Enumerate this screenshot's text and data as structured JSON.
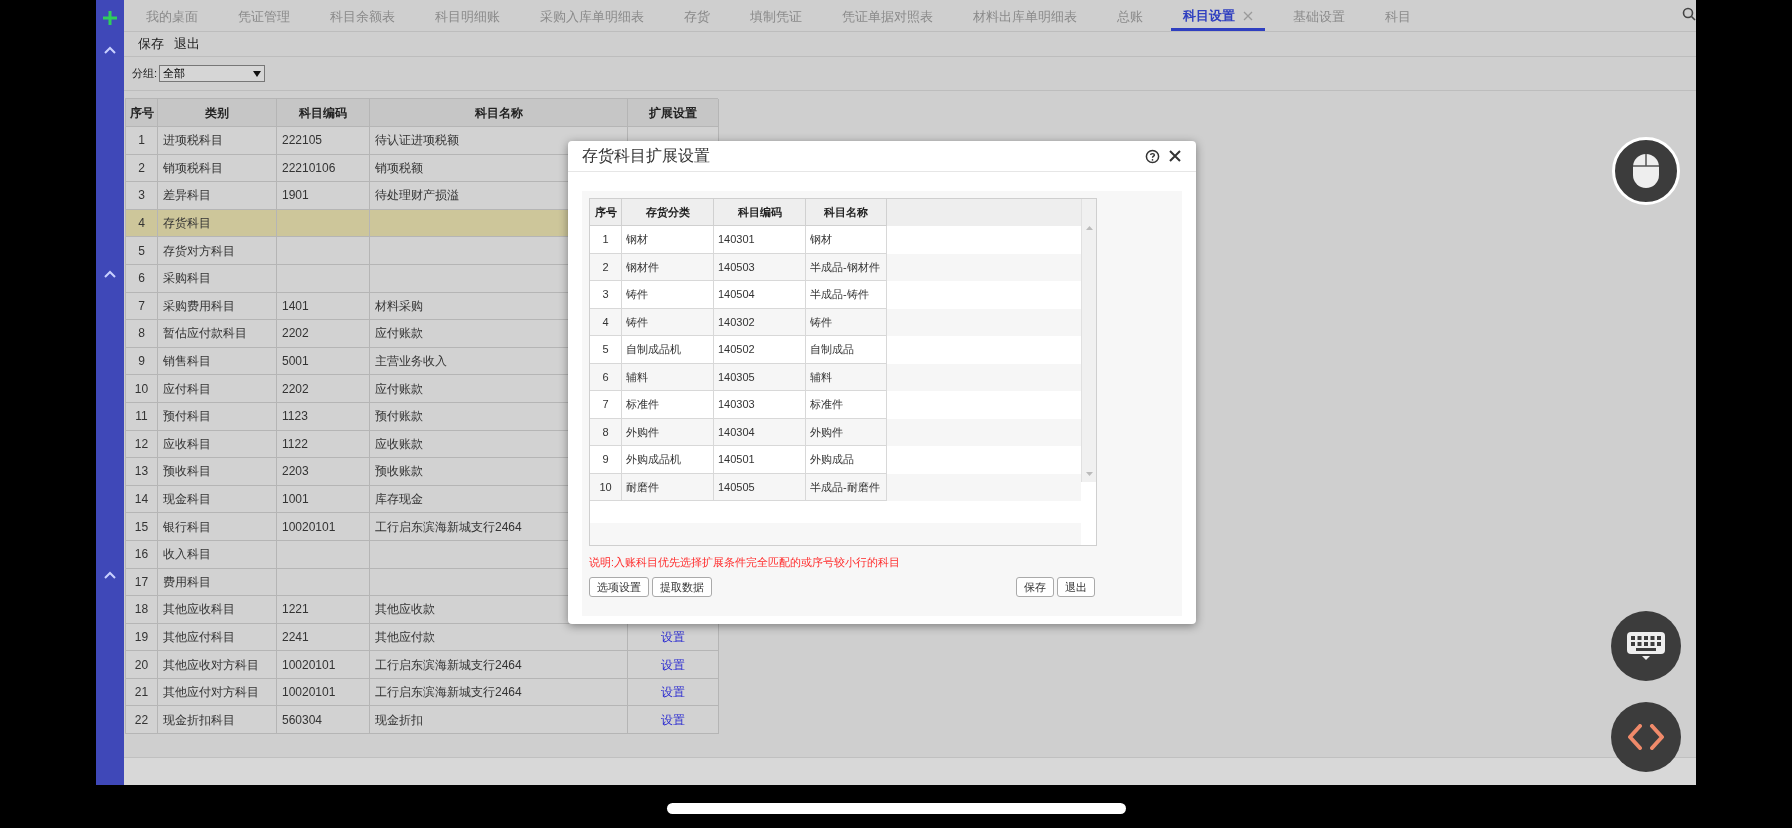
{
  "tabs": [
    {
      "label": "我的桌面",
      "selected": false
    },
    {
      "label": "凭证管理",
      "selected": false
    },
    {
      "label": "科目余额表",
      "selected": false
    },
    {
      "label": "科目明细账",
      "selected": false
    },
    {
      "label": "采购入库单明细表",
      "selected": false
    },
    {
      "label": "存货",
      "selected": false
    },
    {
      "label": "填制凭证",
      "selected": false
    },
    {
      "label": "凭证单据对照表",
      "selected": false
    },
    {
      "label": "材料出库单明细表",
      "selected": false
    },
    {
      "label": "总账",
      "selected": false
    },
    {
      "label": "科目设置",
      "selected": true
    },
    {
      "label": "基础设置",
      "selected": false
    },
    {
      "label": "科目",
      "selected": false
    }
  ],
  "toolbar": [
    "保存",
    "退出"
  ],
  "group": {
    "label": "分组:",
    "value": "全部"
  },
  "table": {
    "columns": [
      "序号",
      "类别",
      "科目编码",
      "科目名称",
      "扩展设置"
    ],
    "rows": [
      {
        "cells": [
          "1",
          "进项税科目",
          "222105",
          "待认证进项税额"
        ],
        "selected": false
      },
      {
        "cells": [
          "2",
          "销项税科目",
          "22210106",
          "销项税额"
        ],
        "selected": false
      },
      {
        "cells": [
          "3",
          "差异科目",
          "1901",
          "待处理财产损溢"
        ],
        "selected": false
      },
      {
        "cells": [
          "4",
          "存货科目",
          "",
          ""
        ],
        "selected": true
      },
      {
        "cells": [
          "5",
          "存货对方科目",
          "",
          ""
        ],
        "selected": false
      },
      {
        "cells": [
          "6",
          "采购科目",
          "",
          ""
        ],
        "selected": false
      },
      {
        "cells": [
          "7",
          "采购费用科目",
          "1401",
          "材料采购"
        ],
        "selected": false
      },
      {
        "cells": [
          "8",
          "暂估应付款科目",
          "2202",
          "应付账款"
        ],
        "selected": false
      },
      {
        "cells": [
          "9",
          "销售科目",
          "5001",
          "主营业务收入"
        ],
        "selected": false
      },
      {
        "cells": [
          "10",
          "应付科目",
          "2202",
          "应付账款"
        ],
        "selected": false
      },
      {
        "cells": [
          "11",
          "预付科目",
          "1123",
          "预付账款"
        ],
        "selected": false
      },
      {
        "cells": [
          "12",
          "应收科目",
          "1122",
          "应收账款"
        ],
        "selected": false
      },
      {
        "cells": [
          "13",
          "预收科目",
          "2203",
          "预收账款"
        ],
        "selected": false
      },
      {
        "cells": [
          "14",
          "现金科目",
          "1001",
          "库存现金"
        ],
        "selected": false
      },
      {
        "cells": [
          "15",
          "银行科目",
          "10020101",
          "工行启东滨海新城支行2464"
        ],
        "selected": false
      },
      {
        "cells": [
          "16",
          "收入科目",
          "",
          ""
        ],
        "selected": false
      },
      {
        "cells": [
          "17",
          "费用科目",
          "",
          ""
        ],
        "selected": false
      },
      {
        "cells": [
          "18",
          "其他应收科目",
          "1221",
          "其他应收款"
        ],
        "selected": false
      },
      {
        "cells": [
          "19",
          "其他应付科目",
          "2241",
          "其他应付款"
        ],
        "selected": false,
        "link": "设置"
      },
      {
        "cells": [
          "20",
          "其他应收对方科目",
          "10020101",
          "工行启东滨海新城支行2464"
        ],
        "selected": false,
        "link": "设置"
      },
      {
        "cells": [
          "21",
          "其他应付对方科目",
          "10020101",
          "工行启东滨海新城支行2464"
        ],
        "selected": false,
        "link": "设置"
      },
      {
        "cells": [
          "22",
          "现金折扣科目",
          "560304",
          "现金折扣"
        ],
        "selected": false,
        "link": "设置"
      }
    ]
  },
  "dialog": {
    "title": "存货科目扩展设置",
    "table": {
      "columns": [
        "序号",
        "存货分类",
        "科目编码",
        "科目名称"
      ],
      "rows": [
        [
          "1",
          "钢材",
          "140301",
          "钢材"
        ],
        [
          "2",
          "钢材件",
          "140503",
          "半成品-钢材件"
        ],
        [
          "3",
          "铸件",
          "140504",
          "半成品-铸件"
        ],
        [
          "4",
          "铸件",
          "140302",
          "铸件"
        ],
        [
          "5",
          "自制成品机",
          "140502",
          "自制成品"
        ],
        [
          "6",
          "辅料",
          "140305",
          "辅料"
        ],
        [
          "7",
          "标准件",
          "140303",
          "标准件"
        ],
        [
          "8",
          "外购件",
          "140304",
          "外购件"
        ],
        [
          "9",
          "外购成品机",
          "140501",
          "外购成品"
        ],
        [
          "10",
          "耐磨件",
          "140505",
          "半成品-耐磨件"
        ]
      ]
    },
    "note": "说明:入账科目优先选择扩展条件完全匹配的或序号较小行的科目",
    "left_buttons": [
      "选项设置",
      "提取数据"
    ],
    "right_buttons": [
      "保存",
      "退出"
    ]
  }
}
